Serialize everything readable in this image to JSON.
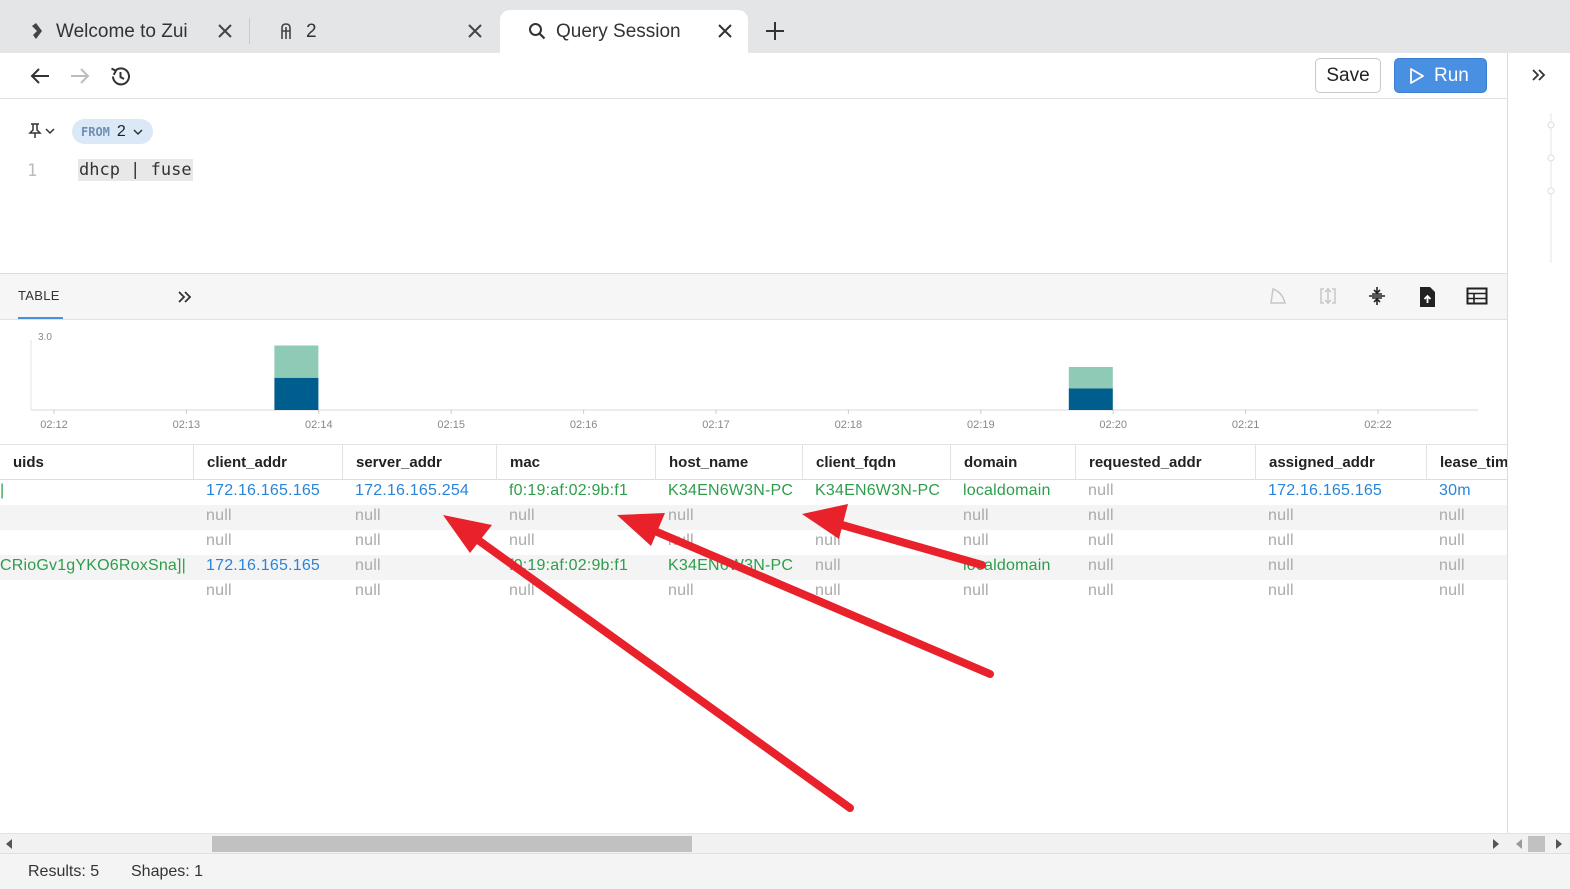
{
  "tabs": [
    {
      "label": "Welcome to Zui",
      "icon": "zui-logo-icon"
    },
    {
      "label": "2",
      "icon": "pool-icon"
    },
    {
      "label": "Query Session",
      "icon": "search-icon",
      "active": true
    }
  ],
  "toolbar": {
    "save_label": "Save",
    "run_label": "Run"
  },
  "editor": {
    "from_keyword": "FROM",
    "from_value": "2",
    "line_number": "1",
    "query": "dhcp | fuse"
  },
  "results": {
    "tab_label": "TABLE"
  },
  "histogram": {
    "y_max_label": "3.0",
    "ticks": [
      "02:12",
      "02:13",
      "02:14",
      "02:15",
      "02:16",
      "02:17",
      "02:18",
      "02:19",
      "02:20",
      "02:21",
      "02:22"
    ],
    "bars": [
      {
        "time": "02:13",
        "segments": [
          {
            "value": 1.5,
            "color": "#008ccc"
          },
          {
            "value": 1.5,
            "color": "#8ecab6"
          }
        ]
      },
      {
        "time": "02:19",
        "segments": [
          {
            "value": 1,
            "color": "#008ccc"
          },
          {
            "value": 1,
            "color": "#8ecab6"
          }
        ]
      }
    ],
    "colors": {
      "primary": "#005e8f",
      "secondary": "#8ecab6"
    }
  },
  "table": {
    "columns": [
      "uids",
      "client_addr",
      "server_addr",
      "mac",
      "host_name",
      "client_fqdn",
      "domain",
      "requested_addr",
      "assigned_addr",
      "lease_time"
    ],
    "rows": [
      [
        "|",
        "172.16.165.165",
        "172.16.165.254",
        "f0:19:af:02:9b:f1",
        "K34EN6W3N-PC",
        "K34EN6W3N-PC",
        "localdomain",
        "null",
        "172.16.165.165",
        "30m"
      ],
      [
        "",
        "null",
        "null",
        "null",
        "null",
        "null",
        "null",
        "null",
        "null",
        "null"
      ],
      [
        "",
        "null",
        "null",
        "null",
        "null",
        "null",
        "null",
        "null",
        "null",
        "null"
      ],
      [
        "CRioGv1gYKO6RoxSna]|",
        "172.16.165.165",
        "null",
        "f0:19:af:02:9b:f1",
        "K34EN6W3N-PC",
        "null",
        "localdomain",
        "null",
        "null",
        "null"
      ],
      [
        "",
        "null",
        "null",
        "null",
        "null",
        "null",
        "null",
        "null",
        "null",
        "null"
      ]
    ]
  },
  "status": {
    "results": "Results: 5",
    "shapes": "Shapes: 1"
  },
  "annotation_color": "#e8212b"
}
